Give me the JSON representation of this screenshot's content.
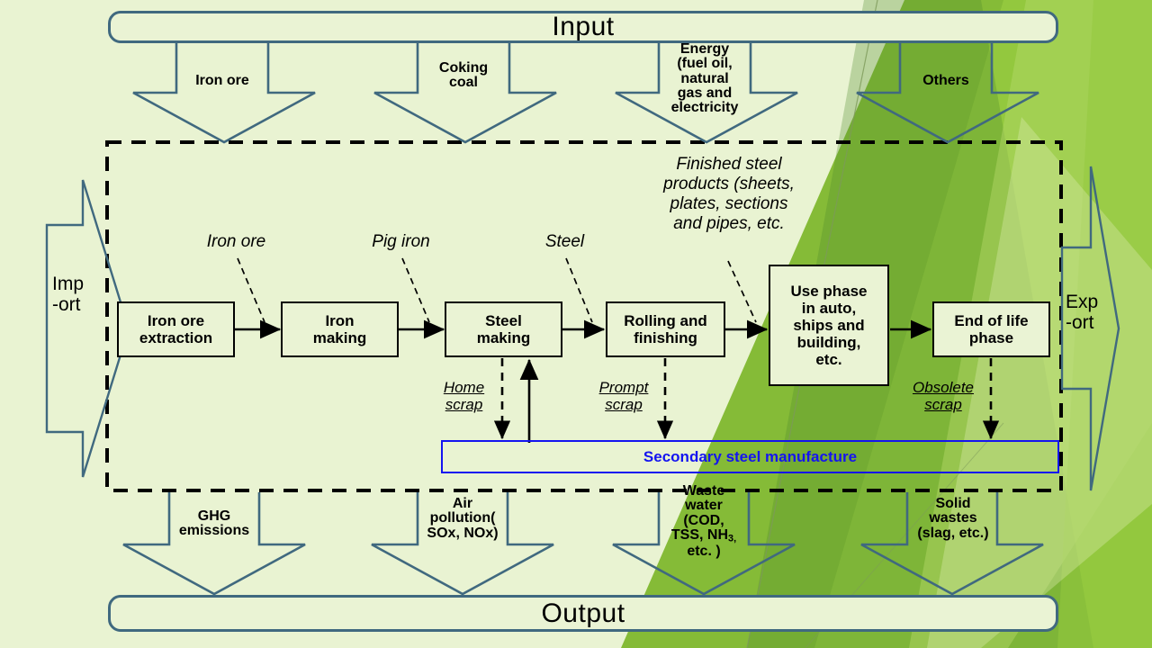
{
  "diagram": {
    "title": "Life cycle system boundary of steel production",
    "background_color": "#e9f3d2",
    "outline_color": "#40697f",
    "box_color": "#000000",
    "secondary_color": "#1414f0",
    "green_accent_1": "#7fb72e",
    "green_accent_2": "#93c83e",
    "green_accent_3": "#6aa033",
    "green_accent_4": "#cfe49a"
  },
  "input_bar": {
    "label": "Input"
  },
  "output_bar": {
    "label": "Output"
  },
  "inputs": [
    {
      "label": "Iron ore"
    },
    {
      "label": "Coking\ncoal"
    },
    {
      "label": "Energy\n(fuel oil,\nnatural\ngas and\nelectricity"
    },
    {
      "label": "Others"
    }
  ],
  "outputs": [
    {
      "label": "GHG\nemissions"
    },
    {
      "label": "Air\npollution(\nSOx, NOx)"
    },
    {
      "label": "Waste\nwater\n(COD,\nTSS, NH3,\netc. )",
      "has_subscript": true
    },
    {
      "label": "Solid\nwastes\n(slag, etc.)"
    }
  ],
  "boundary": {
    "style": "dashed",
    "label": "system boundary"
  },
  "side_flows": {
    "import": {
      "label": "Imp\n-ort"
    },
    "export": {
      "label": "Exp\n-ort"
    }
  },
  "process_chain": [
    {
      "label": "Iron ore\nextraction"
    },
    {
      "label": "Iron\nmaking"
    },
    {
      "label": "Steel\nmaking"
    },
    {
      "label": "Rolling and\nfinishing"
    },
    {
      "label": "Use phase\nin auto,\nships and\nbuilding,\netc."
    },
    {
      "label": "End of life\nphase"
    }
  ],
  "stream_labels": [
    {
      "label": "Iron ore"
    },
    {
      "label": "Pig iron"
    },
    {
      "label": "Steel"
    },
    {
      "label": "Finished steel\nproducts (sheets,\nplates, sections\nand pipes, etc."
    }
  ],
  "scrap_flows": [
    {
      "label": "Home\nscrap"
    },
    {
      "label": "Prompt\nscrap"
    },
    {
      "label": "Obsolete\nscrap"
    }
  ],
  "secondary": {
    "label": "Secondary steel manufacture"
  }
}
